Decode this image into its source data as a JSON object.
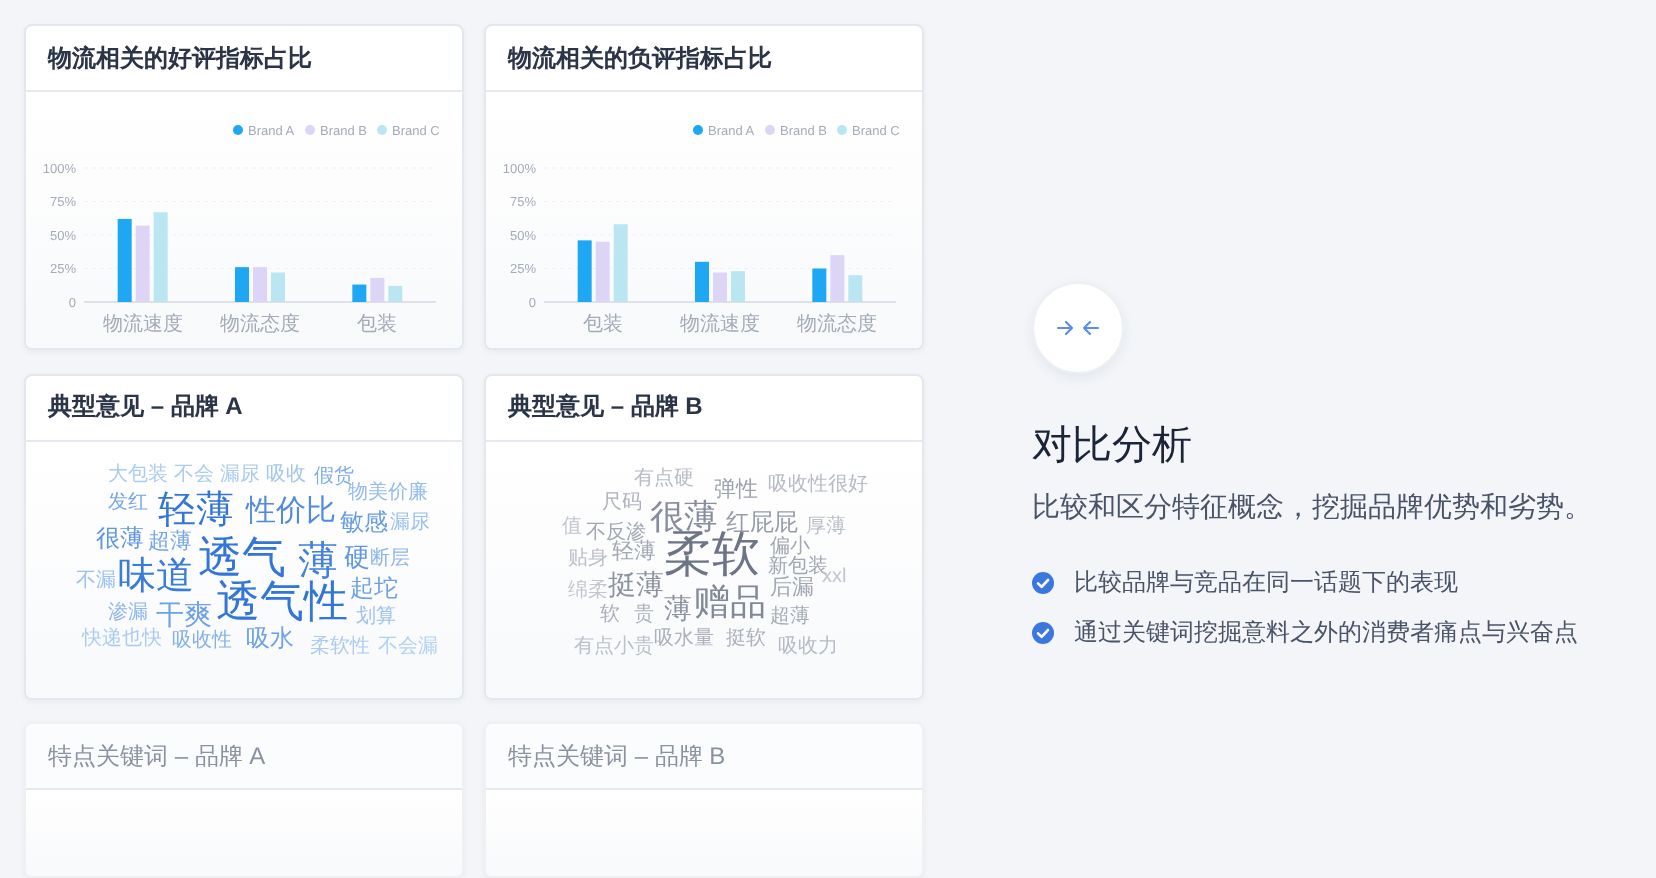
{
  "charts": [
    {
      "title": "物流相关的好评指标占比",
      "chart_data": {
        "type": "bar",
        "categories": [
          "物流速度",
          "物流态度",
          "包装"
        ],
        "series": [
          {
            "name": "Brand A",
            "color": "#1ea8f3",
            "values": [
              62,
              26,
              13
            ]
          },
          {
            "name": "Brand B",
            "color": "#dcd5f6",
            "values": [
              57,
              26,
              18
            ]
          },
          {
            "name": "Brand C",
            "color": "#bae6f1",
            "values": [
              67,
              22,
              12
            ]
          }
        ],
        "ylim": [
          0,
          100
        ],
        "yticks": [
          {
            "value": 0,
            "label": "0"
          },
          {
            "value": 25,
            "label": "25%"
          },
          {
            "value": 50,
            "label": "50%"
          },
          {
            "value": 75,
            "label": "75%"
          },
          {
            "value": 100,
            "label": "100%"
          }
        ],
        "grid": true,
        "legend": "top-right"
      }
    },
    {
      "title": "物流相关的负评指标占比",
      "chart_data": {
        "type": "bar",
        "categories": [
          "包装",
          "物流速度",
          "物流态度"
        ],
        "series": [
          {
            "name": "Brand A",
            "color": "#1ea8f3",
            "values": [
              46,
              30,
              25
            ]
          },
          {
            "name": "Brand B",
            "color": "#dcd5f6",
            "values": [
              45,
              22,
              35
            ]
          },
          {
            "name": "Brand C",
            "color": "#bae6f1",
            "values": [
              58,
              23,
              20
            ]
          }
        ],
        "ylim": [
          0,
          100
        ],
        "yticks": [
          {
            "value": 0,
            "label": "0"
          },
          {
            "value": 25,
            "label": "25%"
          },
          {
            "value": 50,
            "label": "50%"
          },
          {
            "value": 75,
            "label": "75%"
          },
          {
            "value": 100,
            "label": "100%"
          }
        ],
        "grid": true,
        "legend": "top-right"
      }
    }
  ],
  "opinions": [
    {
      "title": "典型意见 – 品牌 A",
      "kind": "blue",
      "words": [
        "大包装",
        "不会 漏尿",
        "吸收",
        "假货",
        "发红",
        "轻薄",
        "性价比",
        "物美价廉",
        "很薄",
        "超薄",
        "敏感",
        "漏尿",
        "透气",
        "薄",
        "硬",
        "断层",
        "不漏",
        "味道",
        "透气性",
        "起坨",
        "渗漏",
        "干爽",
        "划算",
        "快递也快",
        "吸收性",
        "吸水",
        "柔软性",
        "不会漏"
      ]
    },
    {
      "title": "典型意见 – 品牌 B",
      "kind": "grey",
      "words": [
        "有点硬",
        "尺码",
        "弹性",
        "吸收性很好",
        "值",
        "不反渗",
        "很薄",
        "红屁屁",
        "厚薄",
        "贴身",
        "轻薄",
        "柔软",
        "偏小",
        "绵柔",
        "挺薄",
        "新包装",
        "后漏",
        "xxl",
        "软",
        "贵",
        "薄",
        "赠品",
        "超薄",
        "有点小贵",
        "吸水量",
        "挺软",
        "吸收力"
      ]
    }
  ],
  "keyword_cards": [
    {
      "title": "特点关键词 – 品牌 A"
    },
    {
      "title": "特点关键词 – 品牌 B"
    }
  ],
  "feature": {
    "title": "对比分析",
    "subtitle": "比较和区分特征概念，挖掘品牌优势和劣势。",
    "points": [
      "比较品牌与竞品在同一话题下的表现",
      "通过关键词挖掘意料之外的消费者痛点与兴奋点"
    ]
  }
}
